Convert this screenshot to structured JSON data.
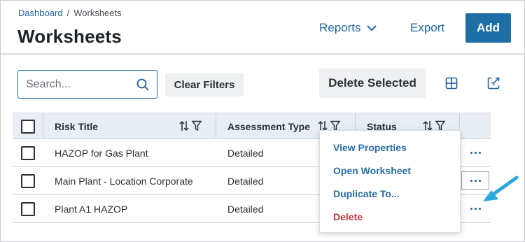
{
  "breadcrumb": {
    "root": "Dashboard",
    "separator": "/",
    "current": "Worksheets"
  },
  "page": {
    "title": "Worksheets"
  },
  "header_actions": {
    "reports": "Reports",
    "export": "Export",
    "add": "Add"
  },
  "toolbar": {
    "search_placeholder": "Search...",
    "clear_filters": "Clear Filters",
    "delete_selected": "Delete Selected"
  },
  "table": {
    "columns": [
      "Risk Title",
      "Assessment Type",
      "Status"
    ],
    "rows": [
      {
        "risk_title": "HAZOP for Gas Plant",
        "assessment_type": "Detailed"
      },
      {
        "risk_title": "Main Plant - Location Corporate",
        "assessment_type": "Detailed"
      },
      {
        "risk_title": "Plant A1 HAZOP",
        "assessment_type": "Detailed"
      }
    ]
  },
  "context_menu": {
    "items": [
      "View Properties",
      "Open Worksheet",
      "Duplicate To...",
      "Delete"
    ]
  },
  "icons": [
    "chevron-down-icon",
    "search-icon",
    "grid-icon",
    "collapse-icon",
    "sort-icon",
    "filter-icon",
    "more-icon",
    "arrow-icon"
  ],
  "colors": {
    "accent": "#1d6fa5",
    "link": "#1f6aa8",
    "danger": "#d1343b",
    "header_bg": "#e8eef4",
    "annotation_arrow": "#29a8db"
  }
}
